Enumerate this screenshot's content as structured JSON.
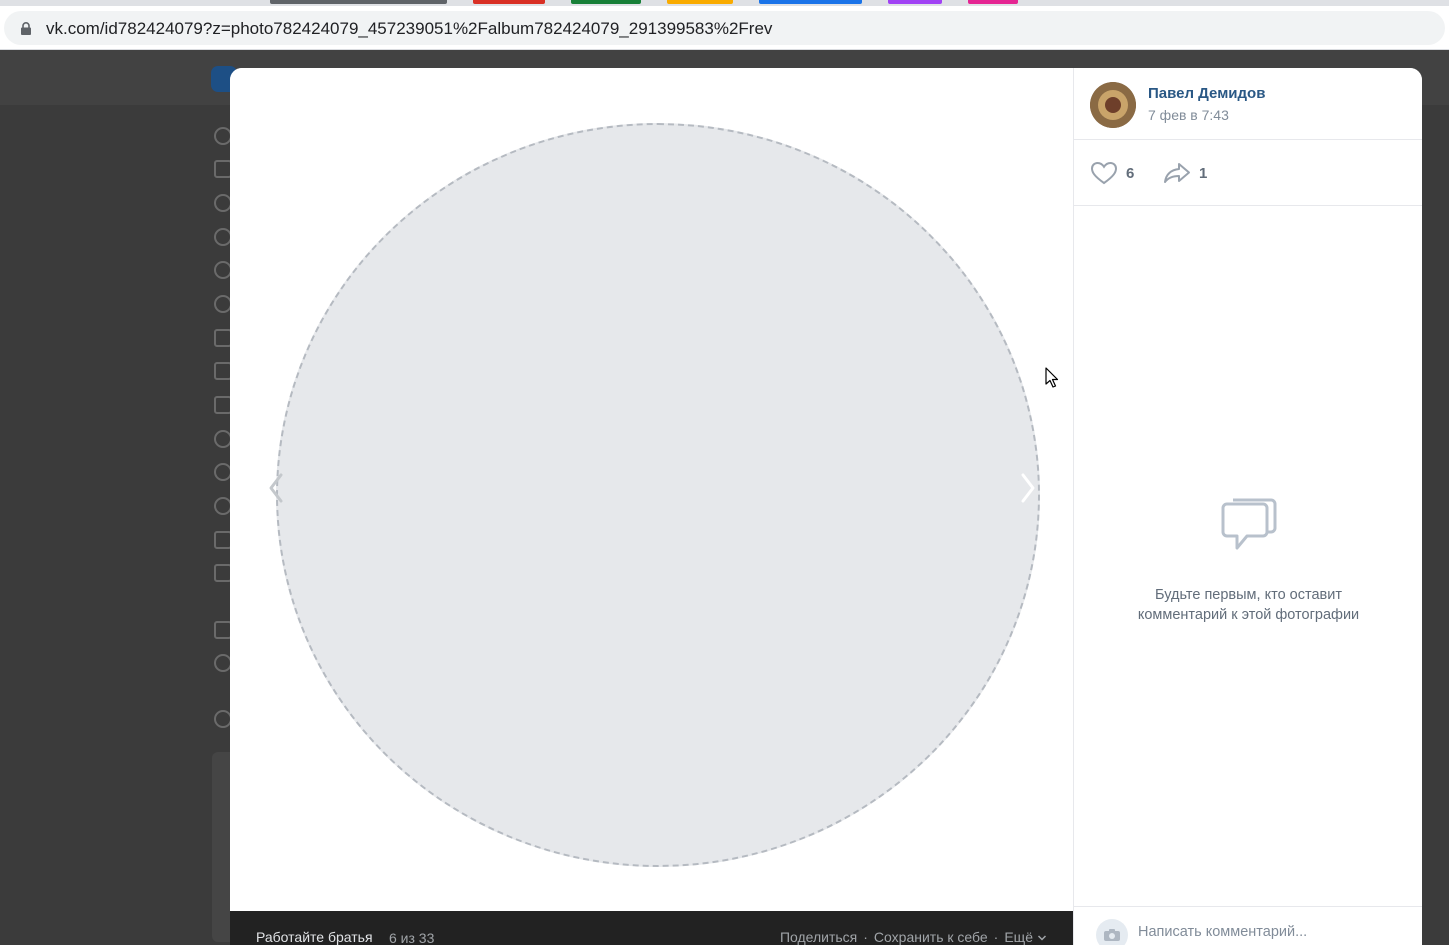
{
  "browser": {
    "url": "vk.com/id782424079?z=photo782424079_457239051%2Falbum782424079_291399583%2Frev",
    "tab_colors": [
      "#5f6368",
      "#d93025",
      "#188038",
      "#f9ab00",
      "#1a73e8",
      "#a142f4",
      "#e52592"
    ]
  },
  "viewer": {
    "photo_placeholder": "",
    "album_title": "Работайте братья",
    "album_count": "6 из 33",
    "actions": {
      "share": "Поделиться",
      "save": "Сохранить к себе",
      "more": "Ещё"
    },
    "separator": "·",
    "nav_prev_icon": "chevron-left-icon",
    "nav_next_icon": "chevron-right-icon"
  },
  "sidebar": {
    "author_name": "Павел Демидов",
    "post_date": "7 фев в 7:43",
    "likes_count": "6",
    "shares_count": "1",
    "empty_comments_text": "Будьте первым, кто оставит комментарий к этой фотографии",
    "comment_placeholder": "Написать комментарий..."
  },
  "colors": {
    "link": "#2a5885",
    "muted": "#818c99",
    "footer_bg": "#222222"
  }
}
